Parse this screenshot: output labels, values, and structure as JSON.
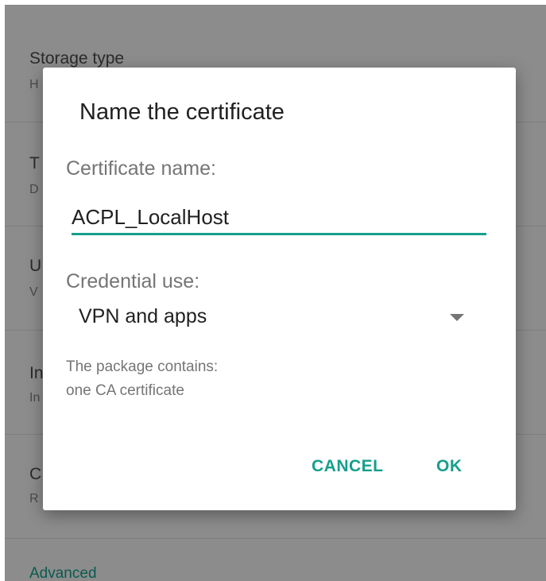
{
  "background": {
    "items": [
      {
        "title": "Storage type",
        "subtitle": "H"
      },
      {
        "title": "T",
        "subtitle": "D"
      },
      {
        "title": "U",
        "subtitle": "V"
      },
      {
        "title": "In",
        "subtitle": "In"
      },
      {
        "title": "C",
        "subtitle": "R"
      }
    ],
    "advanced_label": "Advanced"
  },
  "dialog": {
    "title": "Name the certificate",
    "certificate_name_label": "Certificate name:",
    "certificate_name_value": "ACPL_LocalHost",
    "credential_use_label": "Credential use:",
    "credential_use_selected": "VPN and apps",
    "package_line1": "The package contains:",
    "package_line2": "one CA certificate",
    "cancel_label": "CANCEL",
    "ok_label": "OK"
  },
  "colors": {
    "accent": "#169f8c",
    "scrim_background": "#8c8c8c",
    "dialog_background": "#ffffff"
  },
  "icons": {
    "dropdown": "caret-down-icon"
  }
}
